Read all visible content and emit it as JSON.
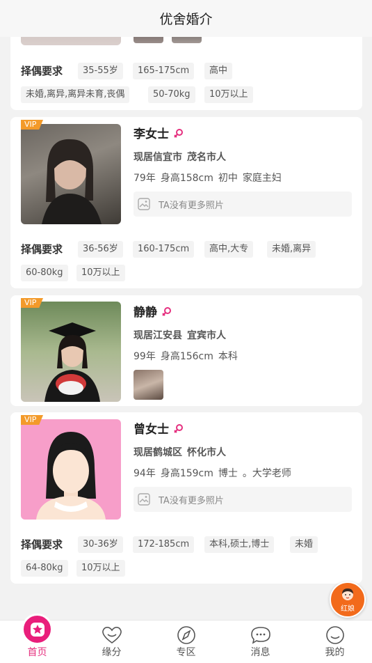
{
  "header": {
    "title": "优舍婚介"
  },
  "top_card": {
    "req_label": "择偶要求",
    "tags_row1": [
      "35-55岁",
      "165-175cm",
      "高中"
    ],
    "tags_row2": [
      "未婚,离异,离异未育,丧偶",
      "50-70kg",
      "10万以上"
    ]
  },
  "profiles": [
    {
      "vip": "VIP",
      "name": "李女士",
      "location": [
        "现居信宜市",
        "茂名市人"
      ],
      "info": [
        "79年",
        "身高158cm",
        "初中",
        "家庭主妇"
      ],
      "no_photo_text": "TA没有更多照片",
      "req_label": "择偶要求",
      "tags_row1": [
        "36-56岁",
        "160-175cm",
        "高中,大专",
        "未婚,离异"
      ],
      "tags_row2": [
        "60-80kg",
        "10万以上"
      ]
    },
    {
      "vip": "VIP",
      "name": "静静",
      "location": [
        "现居江安县",
        "宜宾市人"
      ],
      "info": [
        "99年",
        "身高156cm",
        "本科"
      ]
    },
    {
      "vip": "VIP",
      "name": "曾女士",
      "location": [
        "现居鹤城区",
        "怀化市人"
      ],
      "info": [
        "94年",
        "身高159cm",
        "博士",
        "。大学老师"
      ],
      "no_photo_text": "TA没有更多照片",
      "req_label": "择偶要求",
      "tags_row1": [
        "30-36岁",
        "172-185cm",
        "本科,硕士,博士",
        "未婚"
      ],
      "tags_row2": [
        "64-80kg",
        "10万以上"
      ]
    }
  ],
  "floating": {
    "hongniang_label": "红娘"
  },
  "tabbar": {
    "items": [
      {
        "label": "首页",
        "icon": "home-flower-icon",
        "active": true
      },
      {
        "label": "缘分",
        "icon": "heart-smile-icon"
      },
      {
        "label": "专区",
        "icon": "compass-icon"
      },
      {
        "label": "消息",
        "icon": "chat-bubble-icon"
      },
      {
        "label": "我的",
        "icon": "smile-face-icon"
      }
    ]
  },
  "colors": {
    "accent": "#e5307f",
    "vip": "#f39a2a",
    "hongniang": "#f26a1b"
  }
}
